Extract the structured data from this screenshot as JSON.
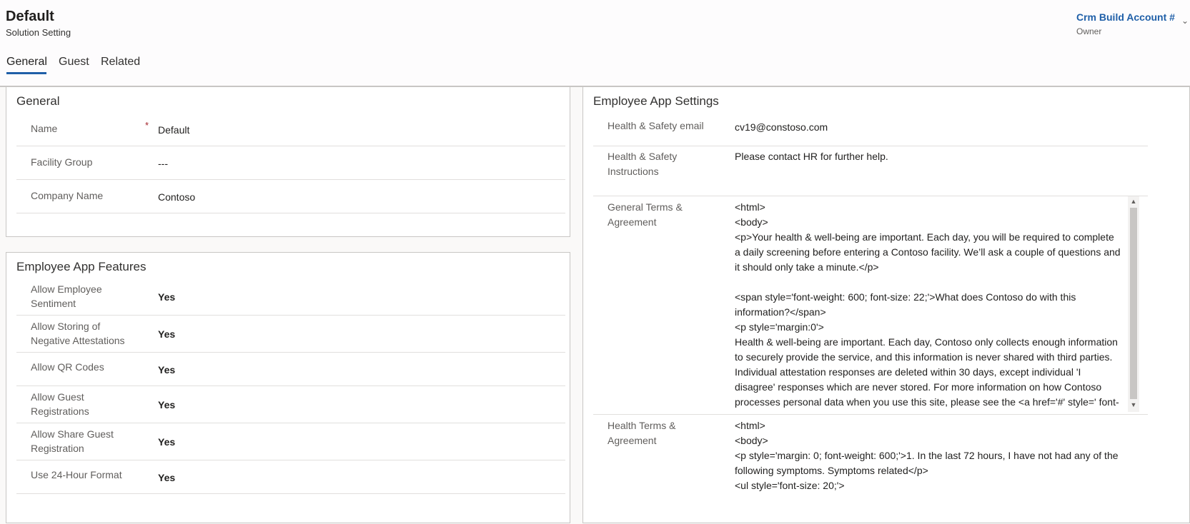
{
  "header": {
    "title": "Default",
    "subtitle": "Solution Setting",
    "owner_name": "Crm Build Account #",
    "owner_label": "Owner"
  },
  "tabs": [
    {
      "label": "General",
      "active": true
    },
    {
      "label": "Guest",
      "active": false
    },
    {
      "label": "Related",
      "active": false
    }
  ],
  "general_section": {
    "title": "General",
    "fields": [
      {
        "label": "Name",
        "value": "Default",
        "required": "*"
      },
      {
        "label": "Facility Group",
        "value": "---"
      },
      {
        "label": "Company Name",
        "value": "Contoso"
      }
    ]
  },
  "features_section": {
    "title": "Employee App Features",
    "fields": [
      {
        "label": "Allow Employee Sentiment",
        "value": "Yes"
      },
      {
        "label": "Allow Storing of Negative Attestations",
        "value": "Yes"
      },
      {
        "label": "Allow QR Codes",
        "value": "Yes"
      },
      {
        "label": "Allow Guest Registrations",
        "value": "Yes"
      },
      {
        "label": "Allow Share Guest Registration",
        "value": "Yes"
      },
      {
        "label": "Use 24-Hour Format",
        "value": "Yes"
      }
    ]
  },
  "settings_section": {
    "title": "Employee App Settings",
    "fields": [
      {
        "label": "Health & Safety email",
        "value": "cv19@constoso.com"
      },
      {
        "label": "Health & Safety Instructions",
        "value": "Please contact HR for further help."
      },
      {
        "label": "General Terms & Agreement",
        "value": "<html>\n<body>\n<p>Your health & well-being are important. Each day, you will be required to complete a daily screening before entering a Contoso facility. We’ll ask a couple of questions and it should only take a minute.</p>\n\n<span style='font-weight: 600; font-size: 22;'>What does Contoso do with this information?</span>\n<p style='margin:0'>\nHealth & well-being are important. Each day, Contoso only collects enough information to securely provide the service, and this information is never shared with third parties. Individual attestation responses are deleted within 30 days, except individual 'I disagree' responses which are never stored. For more information on how Contoso processes personal data when you use this site, please see the <a href='#' style=' font-weight: 600; color: #007991;'>Contoso Data Privacy Notice</a> & <a href='#' style=' font-weight: 600; color:"
      },
      {
        "label": "Health Terms & Agreement",
        "value": "<html>\n<body>\n<p style='margin: 0; font-weight: 600;'>1. In the last 72 hours, I have not had any of the following symptoms. Symptoms related</p>\n<ul style='font-size: 20;'>"
      }
    ]
  }
}
